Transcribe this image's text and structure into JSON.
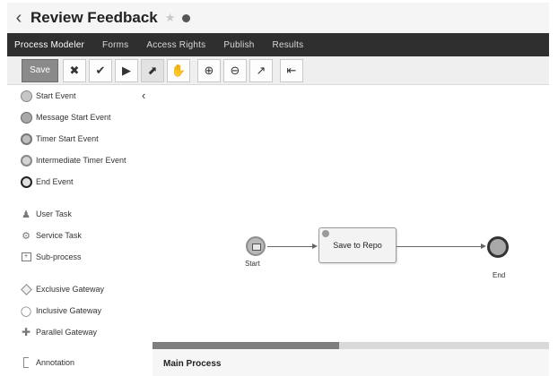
{
  "header": {
    "back_icon": "chevron-left",
    "title": "Review Feedback",
    "star_icon": "star",
    "status_icon": "dot"
  },
  "nav": {
    "tabs": [
      "Process Modeler",
      "Forms",
      "Access Rights",
      "Publish",
      "Results"
    ]
  },
  "toolbar": {
    "save_label": "Save",
    "tools": [
      "tools-icon",
      "check-icon",
      "play-icon",
      "pointer-icon",
      "hand-icon",
      "zoom-in-icon",
      "zoom-out-icon",
      "fit-icon",
      "export-icon"
    ]
  },
  "palette": {
    "items": [
      "Start Event",
      "Message Start Event",
      "Timer Start Event",
      "Intermediate Timer Event",
      "End Event",
      "User Task",
      "Service Task",
      "Sub-process",
      "Exclusive Gateway",
      "Inclusive Gateway",
      "Parallel Gateway",
      "Annotation"
    ]
  },
  "diagram": {
    "start_label": "Start",
    "task_label": "Save to Repo",
    "end_label": "End"
  },
  "bottom": {
    "title": "Main Process"
  },
  "colors": {
    "navbar": "#2f2f2f",
    "toolbar": "#efefef",
    "save_button": "#8a8a8a"
  }
}
